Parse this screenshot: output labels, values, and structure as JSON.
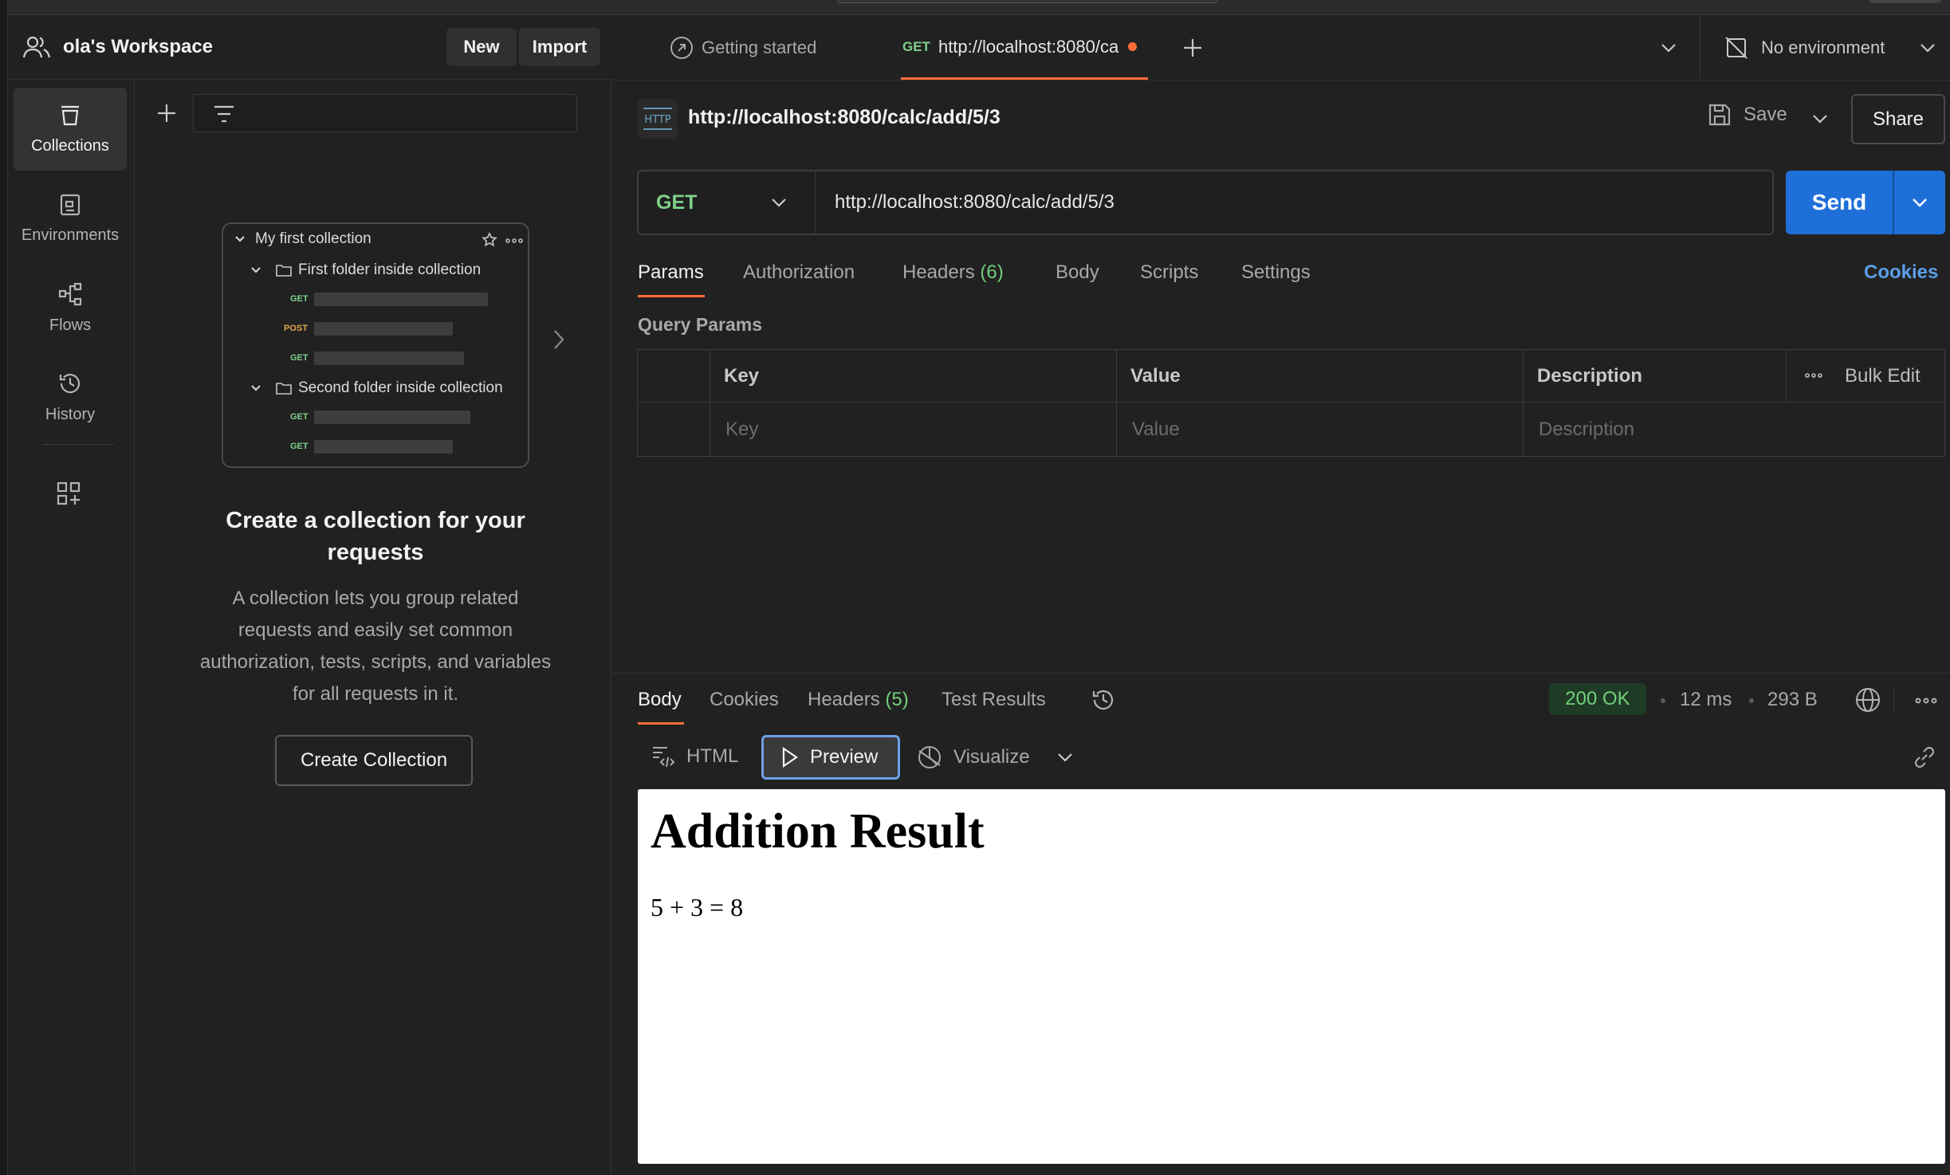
{
  "workspace": {
    "title": "ola's Workspace",
    "new_label": "New",
    "import_label": "Import"
  },
  "nav": {
    "items": [
      {
        "label": "Collections",
        "icon": "collections-icon",
        "active": true
      },
      {
        "label": "Environments",
        "icon": "environments-icon",
        "active": false
      },
      {
        "label": "Flows",
        "icon": "flows-icon",
        "active": false
      },
      {
        "label": "History",
        "icon": "history-icon",
        "active": false
      }
    ]
  },
  "sidebar": {
    "filter_placeholder": "",
    "preview": {
      "collection_name": "My first collection",
      "folder1": "First folder inside collection",
      "folder2": "Second folder inside collection",
      "methods": [
        "GET",
        "POST",
        "GET",
        "GET",
        "GET"
      ]
    },
    "empty_title": "Create a collection for your requests",
    "empty_description": "A collection lets you group related requests and easily set common authorization, tests, scripts, and variables for all requests in it.",
    "create_button": "Create Collection"
  },
  "tabs": {
    "getting_started": "Getting started",
    "active_method": "GET",
    "active_title": "http://localhost:8080/ca",
    "environment": "No environment"
  },
  "request": {
    "title": "http://localhost:8080/calc/add/5/3",
    "save_label": "Save",
    "share_label": "Share",
    "method": "GET",
    "url": "http://localhost:8080/calc/add/5/3",
    "send_label": "Send",
    "tabs": {
      "params": "Params",
      "authorization": "Authorization",
      "headers": "Headers",
      "headers_count": "(6)",
      "body": "Body",
      "scripts": "Scripts",
      "settings": "Settings",
      "cookies": "Cookies"
    },
    "query_params_label": "Query Params",
    "table": {
      "headers": [
        "Key",
        "Value",
        "Description"
      ],
      "bulk_edit": "Bulk Edit",
      "placeholders": [
        "Key",
        "Value",
        "Description"
      ]
    }
  },
  "response": {
    "tabs": {
      "body": "Body",
      "cookies": "Cookies",
      "headers": "Headers",
      "headers_count": "(5)",
      "test_results": "Test Results"
    },
    "status": "200 OK",
    "time": "12 ms",
    "size": "293 B",
    "view_modes": {
      "html": "HTML",
      "preview": "Preview",
      "visualize": "Visualize"
    },
    "preview": {
      "heading": "Addition Result",
      "line": "5 + 3 = 8"
    }
  },
  "colors": {
    "accent": "#ff6c37",
    "send": "#1f6fd9",
    "get": "#7fd18a",
    "post": "#e0a74a",
    "link": "#5a9fe8"
  }
}
